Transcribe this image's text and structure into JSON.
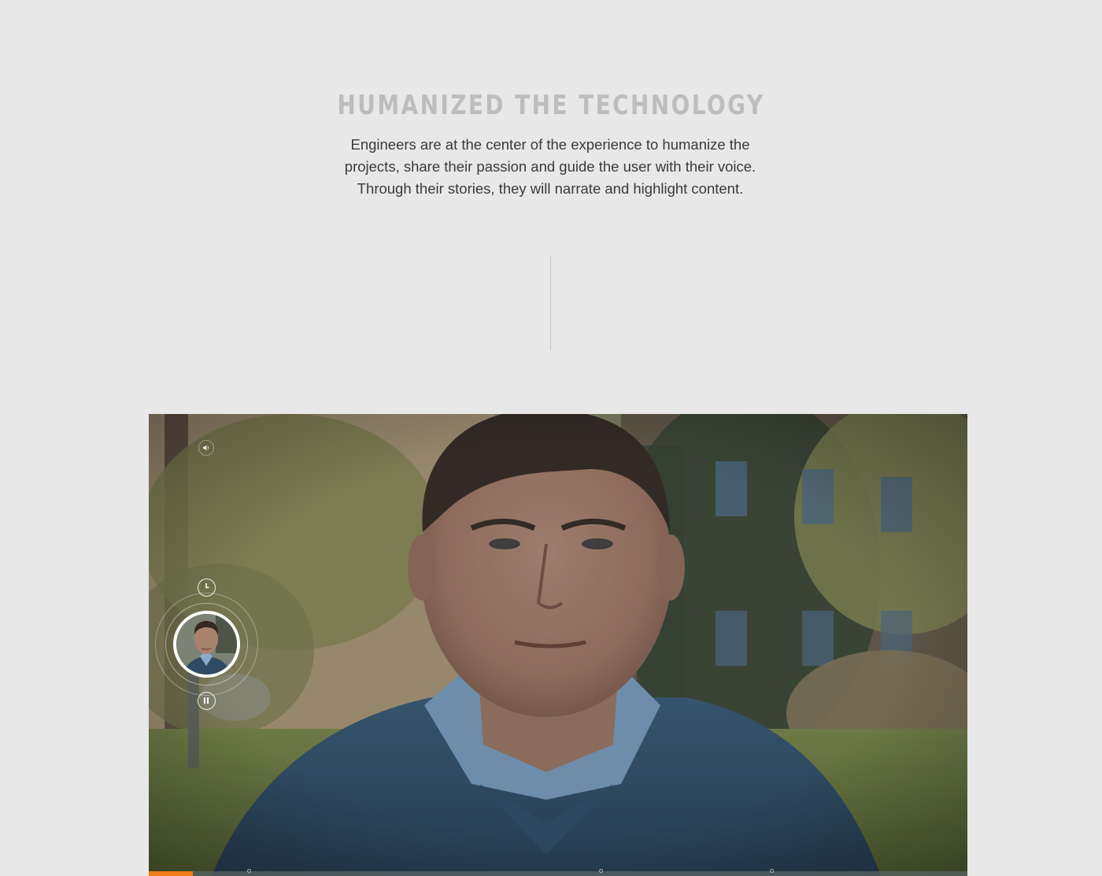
{
  "section": {
    "heading": "HUMANIZED THE TECHNOLOGY",
    "description_lines": [
      "Engineers are at the center of the experience to humanize the",
      "projects, share their passion and guide the user with their voice.",
      "Through their stories, they will narrate and highlight content."
    ]
  },
  "video_player": {
    "icons": {
      "volume": "volume-icon",
      "clock": "clock-icon",
      "pause": "pause-icon",
      "narrator_avatar": "engineer-avatar"
    },
    "progress_fraction": 0.054,
    "chapter_markers": [
      0.122,
      0.552,
      0.761
    ],
    "colors": {
      "progress": "#f07c1a",
      "track": "#5a6464"
    }
  }
}
